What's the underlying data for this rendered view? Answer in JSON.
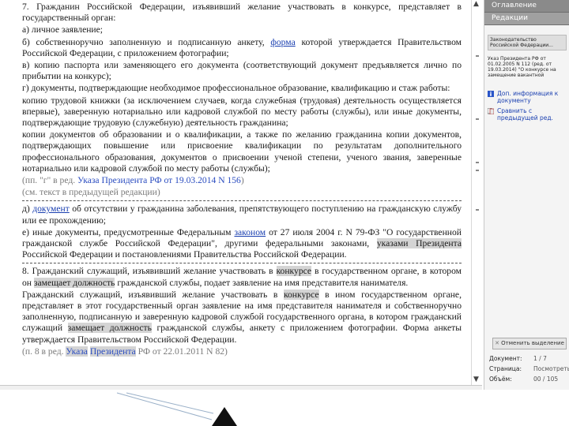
{
  "document": {
    "p1": "7. Гражданин Российской Федерации, изъявивший желание участвовать в конкурсе, представляет в государственный орган:",
    "p2": "а) личное заявление;",
    "p3_a": "б) собственноручно заполненную и подписанную анкету, ",
    "p3_link": "форма",
    "p3_b": " которой утверждается Правительством Российской Федерации, с приложением фотографии;",
    "p4": "в) копию паспорта или заменяющего его документа (соответствующий документ предъявляется лично по прибытии на конкурс);",
    "p5": "г) документы, подтверждающие необходимое профессиональное образование, квалификацию и стаж работы:",
    "p6": "копию трудовой книжки (за исключением случаев, когда служебная (трудовая) деятельность осуществляется впервые), заверенную нотариально или кадровой службой по месту работы (службы), или иные документы, подтверждающие трудовую (служебную) деятельность гражданина;",
    "p7": "копии документов об образовании и о квалификации, а также по желанию гражданина копии документов, подтверждающих повышение или присвоение квалификации по результатам дополнительного профессионального образования, документов о присвоении ученой степени, ученого звания, заверенные нотариально или кадровой службой по месту работы (службы);",
    "note1_a": "(пп. \"г\" в ред. ",
    "note1_link": "Указа Президента РФ от 19.03.2014 N 156",
    "note1_b": ")",
    "note1_c": "(см. текст в предыдущей редакции)",
    "p8_a": "д) ",
    "p8_link": "документ",
    "p8_b": " об отсутствии у гражданина заболевания, препятствующего поступлению на гражданскую службу или ее прохождению;",
    "p9_a": "е) иные документы, предусмотренные Федеральным ",
    "p9_link": "законом",
    "p9_b": " от 27 июля 2004 г. N 79-ФЗ \"О государственной гражданской службе Российской Федерации\", другими федеральными законами, ",
    "p9_hl": "указами Президента",
    "p9_c": " Российской Федерации и постановлениями Правительства Российской Федерации.",
    "p10_a": "8. Гражданский служащий, изъявивший желание участвовать в ",
    "p10_hl1": "конкурсе",
    "p10_b": " в государственном органе, в котором он ",
    "p10_hl2": "замещает должность",
    "p10_c": " гражданской службы, подает заявление на имя представителя нанимателя.",
    "p11_a": "Гражданский служащий, изъявивший желание участвовать в ",
    "p11_hl1": "конкурсе",
    "p11_b": " в ином государственном органе, представляет в этот государственный орган заявление на имя представителя нанимателя и собственноручно заполненную, подписанную и заверенную кадровой службой государственного органа, в котором гражданский служащий ",
    "p11_hl2": "замещает должность",
    "p11_c": " гражданской службы, анкету с приложением фотографии. Форма анкеты утверждается Правительством Российской Федерации.",
    "note2_a": "(п. 8 в ред. ",
    "note2_l1": "Указа",
    "note2_sp": " ",
    "note2_l2": "Президента",
    "note2_b": " РФ от 22.01.2011 N 82)"
  },
  "panel": {
    "tab1": "Оглавление",
    "tab2": "Редакции",
    "item1": "Законодательство Российской Федерации...",
    "item2": "Указ Президента РФ от 01.02.2005 N 112 (ред. от 19.03.2014) \"О конкурсе на замещение вакантной",
    "link1": "Доп. информация к документу",
    "link2": "Сравнить с предыдущей ред.",
    "btn_label": "Отменить выделение",
    "doc_label": "Документ:",
    "doc_value": "1 / 7",
    "page_label": "Страница:",
    "page_value": "Посмотреть",
    "vol_label": "Объём:",
    "vol_value": "00 / 105"
  }
}
